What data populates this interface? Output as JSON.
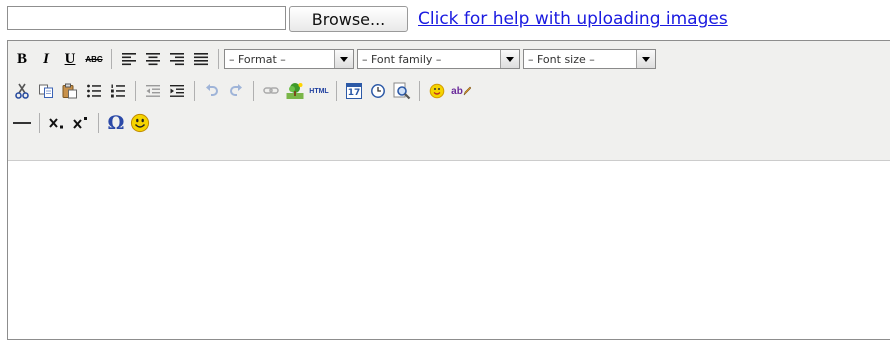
{
  "upload": {
    "browse_label": "Browse...",
    "help_link": "Click for help with uploading images",
    "file_value": ""
  },
  "toolbar": {
    "row1": {
      "bold": "B",
      "italic": "I",
      "underline": "U",
      "strike": "ABC",
      "format_select": "– Format –",
      "font_family_select": "– Font family –",
      "font_size_select": "– Font size –"
    },
    "row2": {
      "html_label": "HTML",
      "date_label": "17",
      "spell_label": "ab"
    },
    "row3": {
      "omega": "Ω"
    }
  },
  "editor": {
    "content": ""
  },
  "colors": {
    "link": "#1a1ae0",
    "toolbar_bg": "#f0f0ee",
    "disabled_icon": "#9a9a9a",
    "emoticon": "#f5d400"
  }
}
